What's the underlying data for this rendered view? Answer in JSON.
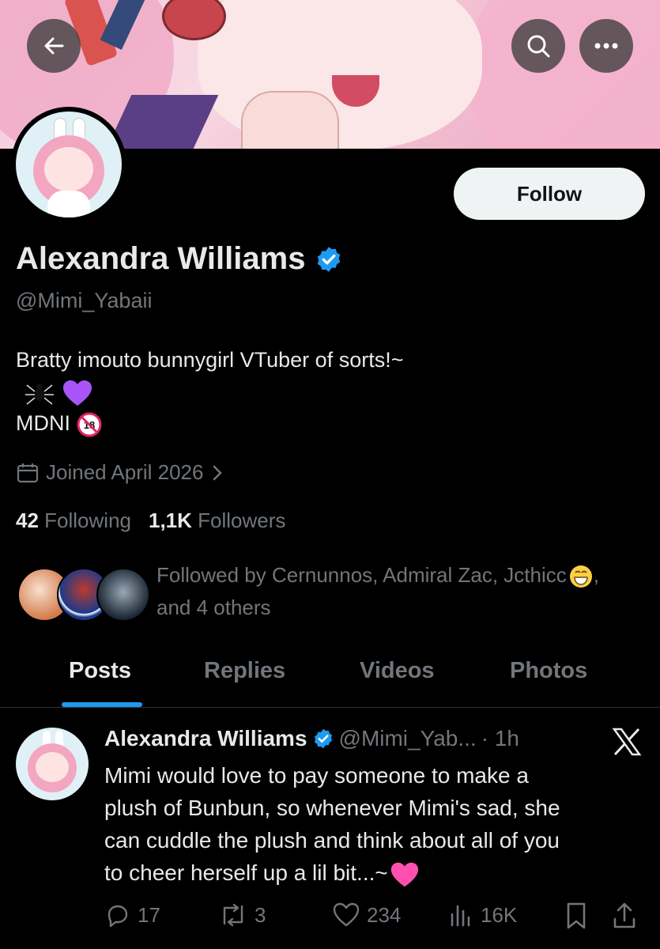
{
  "profile": {
    "name": "Alexandra Williams",
    "handle": "@Mimi_Yabaii",
    "bio_line1": "Bratty imouto bunnygirl VTuber of sorts!~",
    "bio_line3": "MDNI",
    "joined": "Joined April 2026",
    "following_count": "42",
    "following_label": "Following",
    "followers_count": "1,1K",
    "followers_label": "Followers",
    "followed_by_line1": "Followed by Cernunnos, Admiral Zac, Jcthicc",
    "followed_by_line2": "and 4 others",
    "follow_button": "Follow"
  },
  "tabs": [
    {
      "label": "Posts",
      "active": true
    },
    {
      "label": "Replies",
      "active": false
    },
    {
      "label": "Videos",
      "active": false
    },
    {
      "label": "Photos",
      "active": false
    }
  ],
  "post": {
    "name": "Alexandra Williams",
    "handle": "@Mimi_Yab...",
    "time": "· 1h",
    "lines": [
      "Mimi would love to pay someone to make a",
      "plush of Bunbun, so whenever Mimi's sad, she",
      "can cuddle the plush and think about all of you",
      "to cheer herself up a lil bit...~"
    ],
    "replies": "17",
    "reposts": "3",
    "likes": "234",
    "views": "16K"
  },
  "colors": {
    "accent": "#1d9bf0",
    "background": "#000000",
    "muted": "#71767b",
    "text": "#e7e9ea"
  },
  "icons": [
    "back-arrow-icon",
    "search-icon",
    "more-icon",
    "verified-badge-icon",
    "calendar-icon",
    "chevron-right-icon",
    "reply-icon",
    "repost-icon",
    "like-icon",
    "views-icon",
    "bookmark-icon",
    "share-icon",
    "x-logo-icon"
  ]
}
